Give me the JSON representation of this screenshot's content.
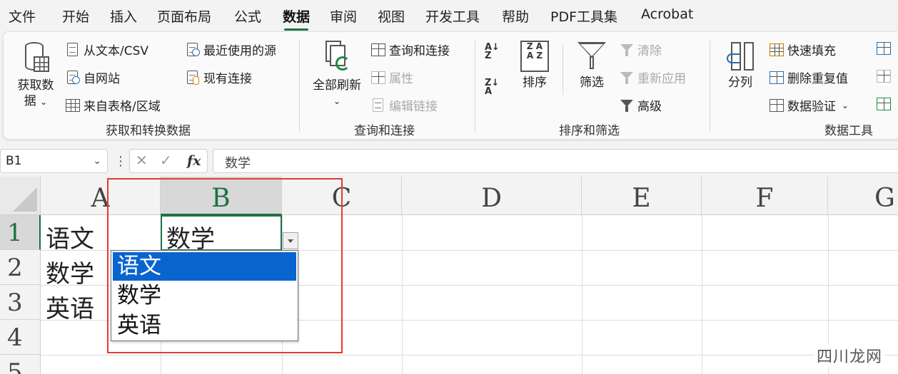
{
  "menubar": {
    "tabs": [
      "文件",
      "开始",
      "插入",
      "页面布局",
      "公式",
      "数据",
      "审阅",
      "视图",
      "开发工具",
      "帮助",
      "PDF工具集",
      "Acrobat"
    ],
    "active": "数据"
  },
  "ribbon": {
    "get_data": {
      "big_label_1": "获取数",
      "big_label_2": "据",
      "items": [
        "从文本/CSV",
        "自网站",
        "来自表格/区域",
        "最近使用的源",
        "现有连接"
      ],
      "group_label": "获取和转换数据"
    },
    "queries": {
      "big_label": "全部刷新",
      "items": [
        "查询和连接",
        "属性",
        "编辑链接"
      ],
      "group_label": "查询和连接"
    },
    "sort_filter": {
      "sort_label": "排序",
      "filter_label": "筛选",
      "items": [
        "清除",
        "重新应用",
        "高级"
      ],
      "group_label": "排序和筛选"
    },
    "data_tools": {
      "split_label": "分列",
      "items": [
        "快速填充",
        "删除重复值",
        "数据验证"
      ],
      "group_label": "数据工具"
    }
  },
  "formula_bar": {
    "name_box": "B1",
    "formula": "数学",
    "fx": "fx"
  },
  "sheet": {
    "columns": [
      "A",
      "B",
      "C",
      "D",
      "E",
      "F",
      "G"
    ],
    "rows": [
      "1",
      "2",
      "3",
      "4",
      "5"
    ],
    "cells": {
      "A1": "语文",
      "A2": "数学",
      "A3": "英语",
      "B1": "数学"
    },
    "dropdown_options": [
      "语文",
      "数学",
      "英语"
    ],
    "dropdown_highlighted": "语文"
  },
  "watermark": "四川龙网",
  "colors": {
    "accent": "#1e7145",
    "highlight": "#0a64d0",
    "annotation": "#e53935"
  }
}
